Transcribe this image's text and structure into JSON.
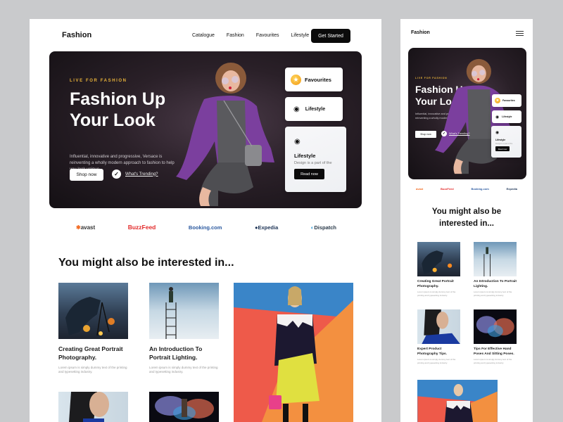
{
  "desktop": {
    "header": {
      "logo": "Fashion",
      "nav": [
        "Catalogue",
        "Fashion",
        "Favourites",
        "Lifestyle"
      ],
      "cta_label": "Get Started"
    },
    "hero": {
      "eyebrow": "LIVE FOR FASHION",
      "title_line1": "Fashion Up",
      "title_line2": "Your Look",
      "description": "Influential, innovative and progressive, Versace is reinventing a wholly modern approach to fashion to help you look unique.",
      "shop_label": "Shop now",
      "trending_label": "What's Trending?",
      "card_favourites": "Favourites",
      "card_lifestyle": "Lifestyle",
      "feature_title": "Lifestyle",
      "feature_desc": "Design is a part of the",
      "feature_button": "Read now"
    },
    "brands": [
      {
        "name": "avast",
        "color": "#f26a21",
        "icon": "avast-logo-icon"
      },
      {
        "name": "BuzzFeed",
        "color": "#e32b2b",
        "icon": ""
      },
      {
        "name": "Booking.com",
        "color": "#2c5aa0",
        "icon": ""
      },
      {
        "name": "Expedia",
        "color": "#1d3456",
        "icon": "expedia-globe-icon"
      },
      {
        "name": "Dispatch",
        "color": "#2a3a4a",
        "icon": "dispatch-logo-icon"
      }
    ],
    "section_title": "You might also be interested in...",
    "articles": [
      {
        "title": "Creating Great Portrait Photography.",
        "excerpt": "Lorem ipsum is simply dummy text of the printing and typesetting industry."
      },
      {
        "title": "An Introduction To Portrait Lighting.",
        "excerpt": "Lorem ipsum is simply dummy text of the printing and typesetting industry."
      }
    ]
  },
  "mobile": {
    "header": {
      "logo": "Fashion"
    },
    "hero": {
      "eyebrow": "LIVE FOR FASHION",
      "title_line1": "Fashion Up",
      "title_line2": "Your Look",
      "description": "Influential, innovative and progressive, Versace is reinventing a wholly modern approach to fashion",
      "shop_label": "Shop now",
      "trending_label": "What's Trending?",
      "card_favourites": "Favourites",
      "card_lifestyle": "Lifestyle",
      "feature_title": "Lifestyle",
      "feature_desc": "Design is a part of the",
      "feature_button": "Read now"
    },
    "brands": [
      "avast",
      "BuzzFeed",
      "Booking.com",
      "Expedia"
    ],
    "section_title": "You might also be interested in...",
    "articles": [
      {
        "title": "Creating Great Portrait Photography.",
        "excerpt": "Lorem ipsum is simply dummy text of the printing and typesetting industry."
      },
      {
        "title": "An Introduction To Portrait Lighting.",
        "excerpt": "Lorem ipsum is simply dummy text of the printing and typesetting industry."
      },
      {
        "title": "Expert Product Photography Tips.",
        "excerpt": "Lorem ipsum is simply dummy text of the printing and typesetting industry."
      },
      {
        "title": "Tips For Effective Hand Poses And Sitting Poses.",
        "excerpt": "Lorem ipsum is simply dummy text of the printing and typesetting industry."
      }
    ]
  }
}
